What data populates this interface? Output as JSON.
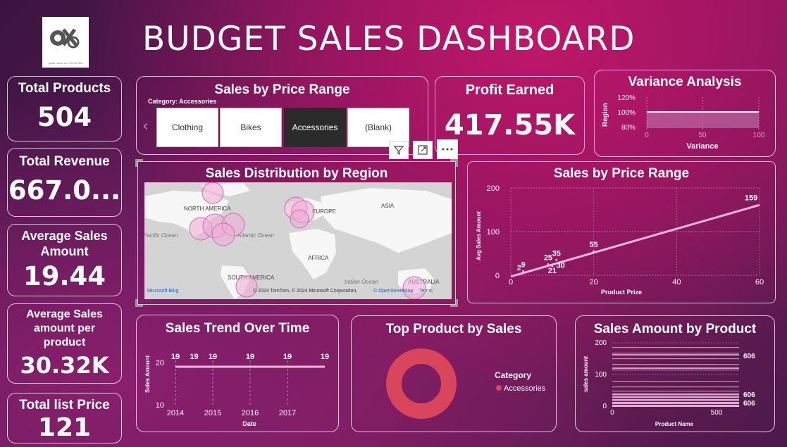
{
  "header": {
    "title": "BUDGET SALES DASHBOARD",
    "logo_text": "globe mech ver. 2.0 eXTRA"
  },
  "kpis": {
    "total_products": {
      "label": "Total Products",
      "value": "504"
    },
    "total_revenue": {
      "label": "Total Revenue",
      "value": "667.0..."
    },
    "avg_sales": {
      "label_line1": "Average Sales",
      "label_line2": "Amount",
      "value": "19.44"
    },
    "avg_per_product": {
      "label_line1": "Average Sales",
      "label_line2": "amount per",
      "label_line3": "product",
      "value": "30.32K"
    },
    "total_list_price": {
      "label": "Total list Price",
      "value": "121"
    },
    "profit": {
      "label": "Profit Earned",
      "value": "417.55K"
    }
  },
  "slicer": {
    "title": "Sales by Price Range",
    "caption": "Category: Accessories",
    "options": [
      "Clothing",
      "Bikes",
      "Accessories",
      "(Blank)"
    ],
    "selected": "Accessories",
    "prev_arrow": "‹"
  },
  "visual_toolbar": {
    "filter": "filter-icon",
    "focus": "focus-mode-icon",
    "more": "more-options-icon"
  },
  "colors": {
    "accent_pink": "#f1a9d6",
    "line_pink": "#f0b8de",
    "donut_red": "#d9455a",
    "selected_btn": "#2b2b2b"
  },
  "map": {
    "title": "Sales Distribution by Region",
    "labels": {
      "north_america": "NORTH AMERICA",
      "europe": "EUROPE",
      "asia": "ASIA",
      "africa": "AFRICA",
      "south_america": "SOUTH AMERICA",
      "australia": "AUSTRALIA",
      "pacific": "Pacific Ocean",
      "atlantic": "Atlantic Ocean",
      "indian": "Indian Ocean"
    },
    "brand": "Microsoft Bing",
    "attribution": "© 2024 TomTom, © 2024 Microsoft Corporation,",
    "osm": "© OpenStreetMap",
    "terms": "Terms"
  },
  "chart_data": [
    {
      "id": "variance",
      "type": "bar",
      "title": "Variance Analysis",
      "xlabel": "Variance",
      "ylabel": "Region",
      "x_ticks": [
        "0",
        "50",
        "100"
      ],
      "y_ticks": [
        "120%",
        "100%",
        "80%"
      ],
      "xlim": [
        0,
        100
      ],
      "ylim": [
        0.8,
        1.2
      ],
      "values": [
        1.0
      ]
    },
    {
      "id": "price_range",
      "type": "line",
      "title": "Sales by Price Range",
      "xlabel": "Product Prize",
      "ylabel": "Avg Sales Amount",
      "xlim": [
        0,
        60
      ],
      "ylim": [
        0,
        200
      ],
      "x_ticks": [
        "0",
        "20",
        "40",
        "60"
      ],
      "y_ticks": [
        "0",
        "100",
        "200"
      ],
      "x": [
        2,
        3,
        9,
        10,
        11,
        12,
        20,
        59
      ],
      "y": [
        2,
        9,
        25,
        21,
        35,
        30,
        55,
        159
      ],
      "labels": [
        "2",
        "9",
        "25",
        "21",
        "35",
        "30",
        "55",
        "159"
      ]
    },
    {
      "id": "trend",
      "type": "line",
      "title": "Sales Trend Over Time",
      "xlabel": "Date",
      "ylabel": "Sales Amount",
      "x": [
        "2014",
        "2015",
        "2016",
        "2017"
      ],
      "x_ticks": [
        "2014",
        "2015",
        "2016",
        "2017"
      ],
      "y_ticks": [
        "20",
        "10"
      ],
      "ylim": [
        10,
        22
      ],
      "points_x": [
        2014.0,
        2014.5,
        2015.0,
        2016.0,
        2017.0,
        2018.0
      ],
      "points_y": [
        19,
        19,
        19,
        19,
        19,
        19
      ],
      "labels": [
        "19",
        "19",
        "19",
        "19",
        "19",
        "19"
      ]
    },
    {
      "id": "top_product",
      "type": "pie",
      "title": "Top Product by Sales",
      "legend_title": "Category",
      "series": [
        {
          "name": "Accessories",
          "values": [
            100
          ]
        }
      ]
    },
    {
      "id": "amount_by_product",
      "type": "bar",
      "title": "Sales Amount by Product",
      "xlabel": "Product Name",
      "ylabel": "sales amount",
      "x_ticks": [
        "0",
        "500"
      ],
      "y_ticks": [
        "200",
        "100",
        "0"
      ],
      "ylim": [
        0,
        200
      ],
      "labels": [
        "606",
        "606",
        "606"
      ]
    }
  ]
}
